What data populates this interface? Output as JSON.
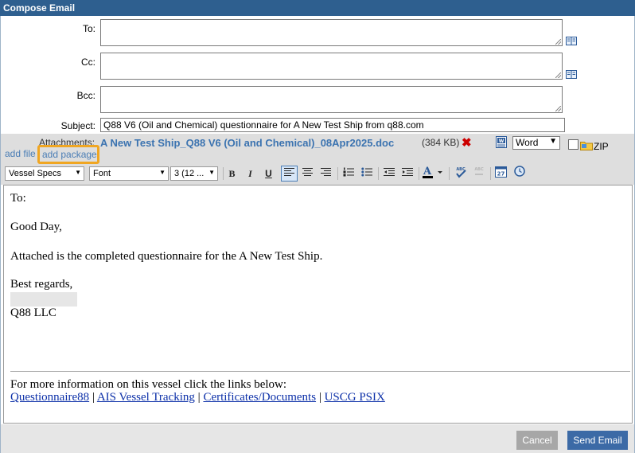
{
  "window": {
    "title": "Compose Email"
  },
  "fields": {
    "to_label": "To:",
    "cc_label": "Cc:",
    "bcc_label": "Bcc:",
    "subject_label": "Subject:",
    "subject_value": "Q88 V6 (Oil and Chemical) questionnaire for A New Test Ship from q88.com"
  },
  "attachments": {
    "label": "Attachments:",
    "file_name": "A New Test Ship_Q88 V6 (Oil and Chemical)_08Apr2025.doc",
    "size": "(384 KB)",
    "format_selected": "Word",
    "zip_label": "ZIP",
    "add_file": "add file",
    "add_package": "add package"
  },
  "toolbar": {
    "template_select": "Vessel Specs",
    "font_select": "Font",
    "size_select": "3 (12 ...",
    "bold": "B",
    "italic": "I",
    "underline": "U"
  },
  "body": {
    "to_line": "To:",
    "greeting": "Good Day,",
    "paragraph": "Attached is the completed questionnaire for the A New Test Ship.",
    "closing": "Best regards,",
    "company": "Q88 LLC",
    "info_line": "For more information on this vessel click the links below:",
    "links": [
      "Questionnaire88",
      "AIS Vessel Tracking",
      "Certificates/Documents",
      "USCG PSIX"
    ],
    "separator": "|"
  },
  "buttons": {
    "cancel": "Cancel",
    "send": "Send Email"
  },
  "colors": {
    "title_bar": "#2e5f8f",
    "link": "#4a7db5",
    "highlight": "#f0a622",
    "send": "#3c6aa6"
  }
}
